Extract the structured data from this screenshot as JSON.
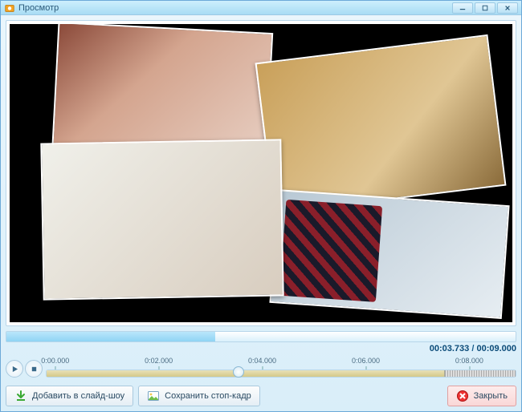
{
  "titlebar": {
    "title": "Просмотр"
  },
  "time": {
    "current": "00:03.733",
    "separator": " / ",
    "total": "00:09.000"
  },
  "ruler": {
    "ticks": [
      {
        "label": "0:00.000",
        "pos": 0
      },
      {
        "label": "0:02.000",
        "pos": 22
      },
      {
        "label": "0:04.000",
        "pos": 44
      },
      {
        "label": "0:06.000",
        "pos": 66
      },
      {
        "label": "0:08.000",
        "pos": 88
      }
    ]
  },
  "buttons": {
    "add_to_slideshow": "Добавить в слайд-шоу",
    "save_frame": "Сохранить стоп-кадр",
    "close": "Закрыть"
  }
}
